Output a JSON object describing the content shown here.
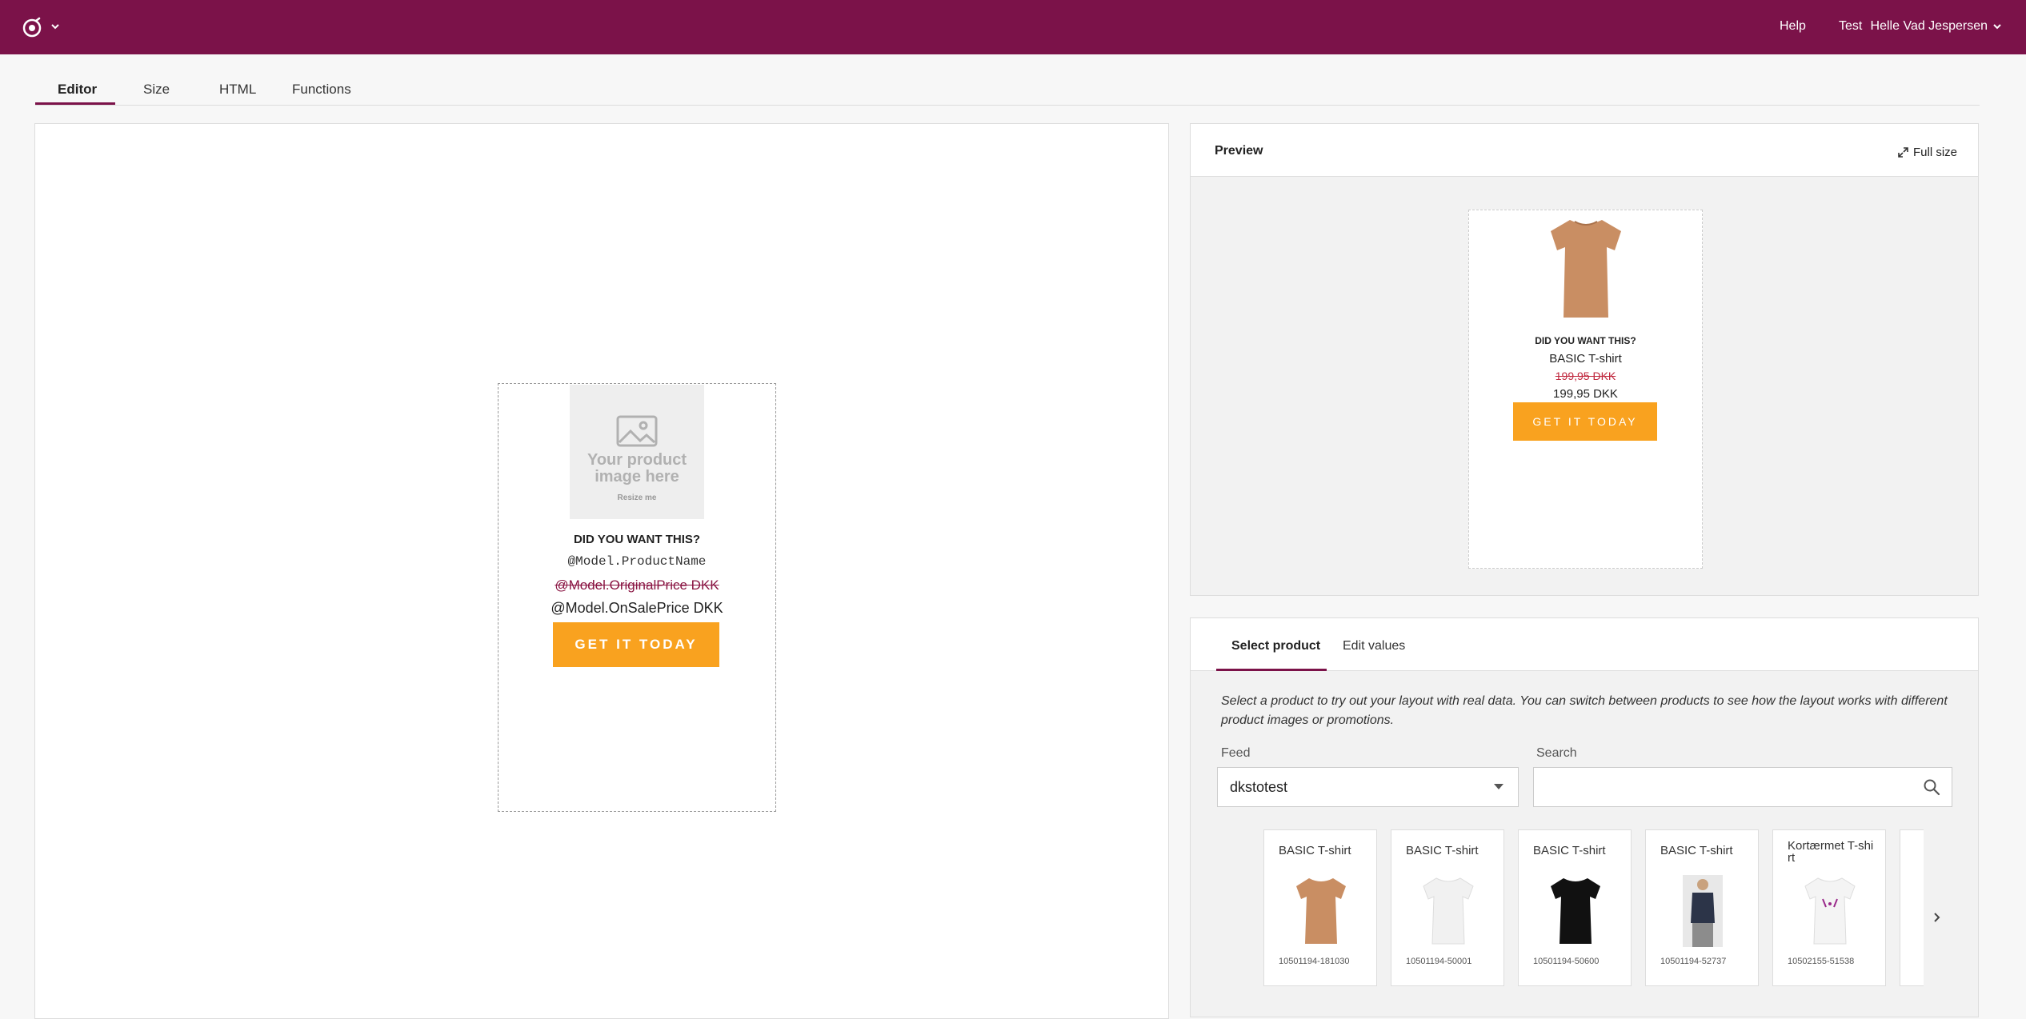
{
  "topbar": {
    "help_label": "Help",
    "test_label": "Test",
    "user_name": "Helle Vad Jespersen",
    "brand_color": "#7b1249"
  },
  "tabs": [
    {
      "label": "Editor",
      "active": true
    },
    {
      "label": "Size",
      "active": false
    },
    {
      "label": "HTML",
      "active": false
    },
    {
      "label": "Functions",
      "active": false
    }
  ],
  "editor": {
    "placeholder_text": "Your product image here",
    "resize_hint": "Resize me",
    "headline": "DID YOU WANT THIS?",
    "product_name": "@Model.ProductName",
    "original_price": "@Model.OriginalPrice DKK",
    "sale_price": "@Model.OnSalePrice DKK",
    "cta_label": "GET IT TODAY",
    "cta_color": "#f9a21f"
  },
  "preview": {
    "title": "Preview",
    "fullsize_label": "Full size",
    "headline": "DID YOU WANT THIS?",
    "product_name": "BASIC T-shirt",
    "original_price": "199,95 DKK",
    "sale_price": "199,95 DKK",
    "cta_label": "GET IT TODAY"
  },
  "select": {
    "tabs": [
      {
        "label": "Select product",
        "active": true
      },
      {
        "label": "Edit values",
        "active": false
      }
    ],
    "description": "Select a product to try out your layout with real data. You can switch between products to see how the layout works with different product images or promotions.",
    "feed_label": "Feed",
    "feed_value": "dkstotest",
    "search_label": "Search",
    "search_value": "",
    "products": [
      {
        "name": "BASIC T-shirt",
        "sku": "10501194-181030",
        "color": "#c98e63"
      },
      {
        "name": "BASIC T-shirt",
        "sku": "10501194-50001",
        "color": "#f1f1f1"
      },
      {
        "name": "BASIC T-shirt",
        "sku": "10501194-50600",
        "color": "#111111"
      },
      {
        "name": "BASIC T-shirt",
        "sku": "10501194-52737",
        "color": "#2c3448"
      },
      {
        "name": "Kortærmet T-shirt",
        "sku": "10502155-51538",
        "color": "#f4f4f4"
      }
    ]
  }
}
